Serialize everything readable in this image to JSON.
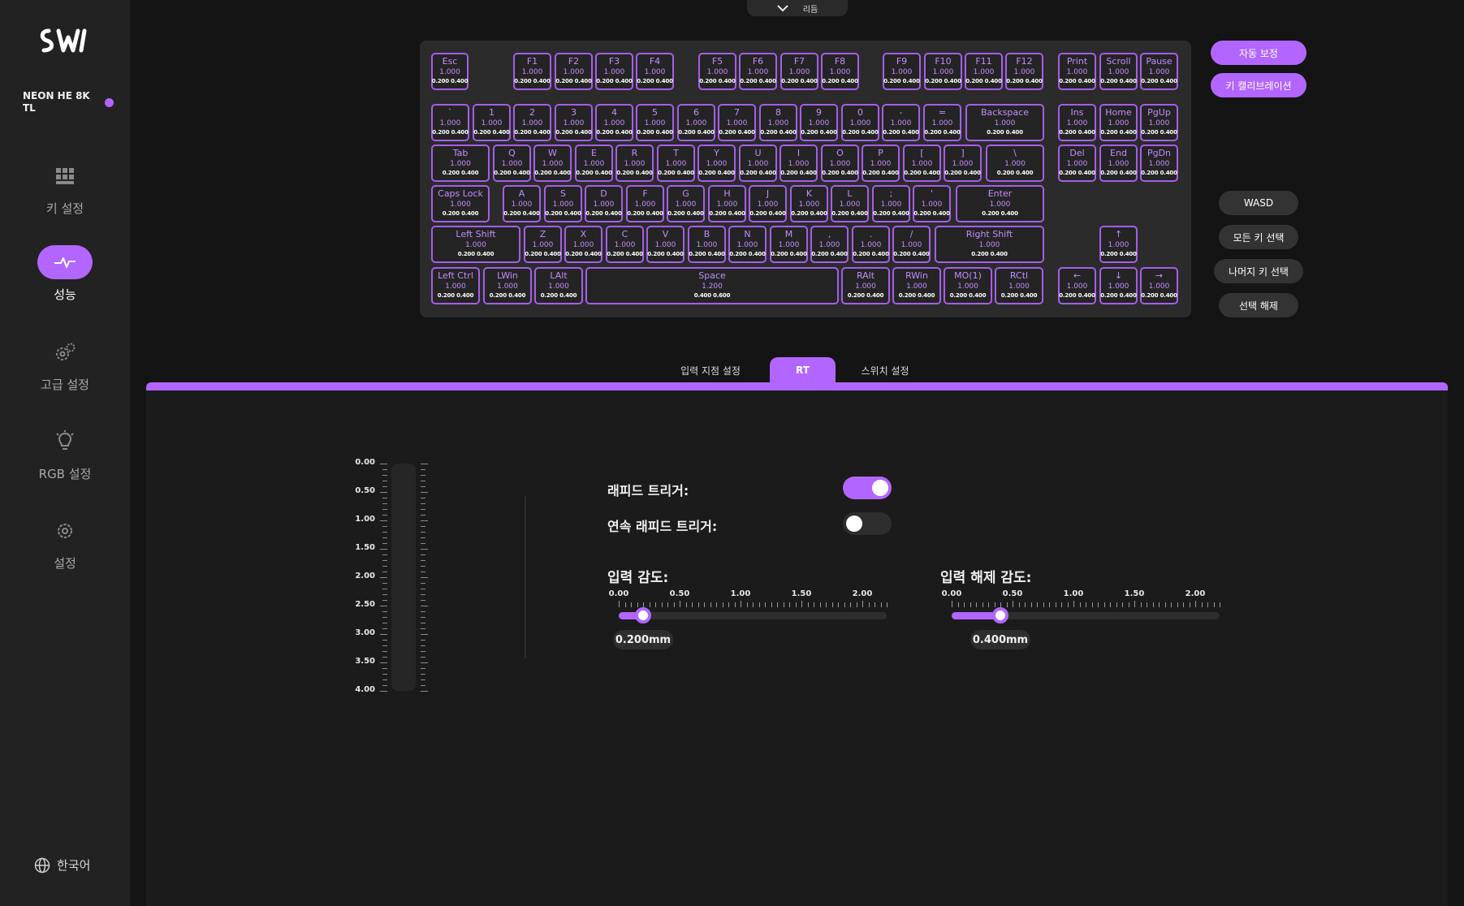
{
  "app": {
    "device_name": "NEON HE 8K TL",
    "status_color": "#b266ff"
  },
  "top_tab": {
    "label": "리듬"
  },
  "sidebar": {
    "items": [
      {
        "label": "키 설정",
        "icon": "grid-icon"
      },
      {
        "label": "성능",
        "icon": "pulse-icon",
        "active": true
      },
      {
        "label": "고급 설정",
        "icon": "gears-icon"
      },
      {
        "label": "RGB 설정",
        "icon": "bulb-icon"
      },
      {
        "label": "설정",
        "icon": "gear-icon"
      }
    ],
    "language": "한국어"
  },
  "keyboard": {
    "rows": [
      [
        {
          "label": "Esc",
          "val": "1.000",
          "sub": "0.200 0.400"
        },
        {
          "label": "F1",
          "val": "1.000",
          "sub": "0.200 0.400"
        },
        {
          "label": "F2",
          "val": "1.000",
          "sub": "0.200 0.400"
        },
        {
          "label": "F3",
          "val": "1.000",
          "sub": "0.200 0.400"
        },
        {
          "label": "F4",
          "val": "1.000",
          "sub": "0.200 0.400"
        },
        {
          "label": "F5",
          "val": "1.000",
          "sub": "0.200 0.400"
        },
        {
          "label": "F6",
          "val": "1.000",
          "sub": "0.200 0.400"
        },
        {
          "label": "F7",
          "val": "1.000",
          "sub": "0.200 0.400"
        },
        {
          "label": "F8",
          "val": "1.000",
          "sub": "0.200 0.400"
        },
        {
          "label": "F9",
          "val": "1.000",
          "sub": "0.200 0.400"
        },
        {
          "label": "F10",
          "val": "1.000",
          "sub": "0.200 0.400"
        },
        {
          "label": "F11",
          "val": "1.000",
          "sub": "0.200 0.400"
        },
        {
          "label": "F12",
          "val": "1.000",
          "sub": "0.200 0.400"
        },
        {
          "label": "Print",
          "val": "1.000",
          "sub": "0.200 0.400"
        },
        {
          "label": "Scroll",
          "val": "1.000",
          "sub": "0.200 0.400"
        },
        {
          "label": "Pause",
          "val": "1.000",
          "sub": "0.200 0.400"
        }
      ],
      [
        {
          "label": "`",
          "val": "1.000",
          "sub": "0.200 0.400"
        },
        {
          "label": "1",
          "val": "1.000",
          "sub": "0.200 0.400"
        },
        {
          "label": "2",
          "val": "1.000",
          "sub": "0.200 0.400"
        },
        {
          "label": "3",
          "val": "1.000",
          "sub": "0.200 0.400"
        },
        {
          "label": "4",
          "val": "1.000",
          "sub": "0.200 0.400"
        },
        {
          "label": "5",
          "val": "1.000",
          "sub": "0.200 0.400"
        },
        {
          "label": "6",
          "val": "1.000",
          "sub": "0.200 0.400"
        },
        {
          "label": "7",
          "val": "1.000",
          "sub": "0.200 0.400"
        },
        {
          "label": "8",
          "val": "1.000",
          "sub": "0.200 0.400"
        },
        {
          "label": "9",
          "val": "1.000",
          "sub": "0.200 0.400"
        },
        {
          "label": "0",
          "val": "1.000",
          "sub": "0.200 0.400"
        },
        {
          "label": "-",
          "val": "1.000",
          "sub": "0.200 0.400"
        },
        {
          "label": "=",
          "val": "1.000",
          "sub": "0.200 0.400"
        },
        {
          "label": "Backspace",
          "val": "1.000",
          "sub": "0.200 0.400"
        },
        {
          "label": "Ins",
          "val": "1.000",
          "sub": "0.200 0.400"
        },
        {
          "label": "Home",
          "val": "1.000",
          "sub": "0.200 0.400"
        },
        {
          "label": "PgUp",
          "val": "1.000",
          "sub": "0.200 0.400"
        }
      ],
      [
        {
          "label": "Tab",
          "val": "1.000",
          "sub": "0.200 0.400"
        },
        {
          "label": "Q",
          "val": "1.000",
          "sub": "0.200 0.400"
        },
        {
          "label": "W",
          "val": "1.000",
          "sub": "0.200 0.400"
        },
        {
          "label": "E",
          "val": "1.000",
          "sub": "0.200 0.400"
        },
        {
          "label": "R",
          "val": "1.000",
          "sub": "0.200 0.400"
        },
        {
          "label": "T",
          "val": "1.000",
          "sub": "0.200 0.400"
        },
        {
          "label": "Y",
          "val": "1.000",
          "sub": "0.200 0.400"
        },
        {
          "label": "U",
          "val": "1.000",
          "sub": "0.200 0.400"
        },
        {
          "label": "I",
          "val": "1.000",
          "sub": "0.200 0.400"
        },
        {
          "label": "O",
          "val": "1.000",
          "sub": "0.200 0.400"
        },
        {
          "label": "P",
          "val": "1.000",
          "sub": "0.200 0.400"
        },
        {
          "label": "[",
          "val": "1.000",
          "sub": "0.200 0.400"
        },
        {
          "label": "]",
          "val": "1.000",
          "sub": "0.200 0.400"
        },
        {
          "label": "\\",
          "val": "1.000",
          "sub": "0.200 0.400"
        },
        {
          "label": "Del",
          "val": "1.000",
          "sub": "0.200 0.400"
        },
        {
          "label": "End",
          "val": "1.000",
          "sub": "0.200 0.400"
        },
        {
          "label": "PgDn",
          "val": "1.000",
          "sub": "0.200 0.400"
        }
      ],
      [
        {
          "label": "Caps Lock",
          "val": "1.000",
          "sub": "0.200 0.400"
        },
        {
          "label": "A",
          "val": "1.000",
          "sub": "0.200 0.400"
        },
        {
          "label": "S",
          "val": "1.000",
          "sub": "0.200 0.400"
        },
        {
          "label": "D",
          "val": "1.000",
          "sub": "0.200 0.400"
        },
        {
          "label": "F",
          "val": "1.000",
          "sub": "0.200 0.400"
        },
        {
          "label": "G",
          "val": "1.000",
          "sub": "0.200 0.400"
        },
        {
          "label": "H",
          "val": "1.000",
          "sub": "0.200 0.400"
        },
        {
          "label": "J",
          "val": "1.000",
          "sub": "0.200 0.400"
        },
        {
          "label": "K",
          "val": "1.000",
          "sub": "0.200 0.400"
        },
        {
          "label": "L",
          "val": "1.000",
          "sub": "0.200 0.400"
        },
        {
          "label": ";",
          "val": "1.000",
          "sub": "0.200 0.400"
        },
        {
          "label": "'",
          "val": "1.000",
          "sub": "0.200 0.400"
        },
        {
          "label": "Enter",
          "val": "1.000",
          "sub": "0.200 0.400"
        }
      ],
      [
        {
          "label": "Left Shift",
          "val": "1.000",
          "sub": "0.200 0.400"
        },
        {
          "label": "Z",
          "val": "1.000",
          "sub": "0.200 0.400"
        },
        {
          "label": "X",
          "val": "1.000",
          "sub": "0.200 0.400"
        },
        {
          "label": "C",
          "val": "1.000",
          "sub": "0.200 0.400"
        },
        {
          "label": "V",
          "val": "1.000",
          "sub": "0.200 0.400"
        },
        {
          "label": "B",
          "val": "1.000",
          "sub": "0.200 0.400"
        },
        {
          "label": "N",
          "val": "1.000",
          "sub": "0.200 0.400"
        },
        {
          "label": "M",
          "val": "1.000",
          "sub": "0.200 0.400"
        },
        {
          "label": ",",
          "val": "1.000",
          "sub": "0.200 0.400"
        },
        {
          "label": ".",
          "val": "1.000",
          "sub": "0.200 0.400"
        },
        {
          "label": "/",
          "val": "1.000",
          "sub": "0.200 0.400"
        },
        {
          "label": "Right Shift",
          "val": "1.000",
          "sub": "0.200 0.400"
        },
        {
          "label": "↑",
          "val": "1.000",
          "sub": "0.200 0.400"
        }
      ],
      [
        {
          "label": "Left Ctrl",
          "val": "1.000",
          "sub": "0.200 0.400"
        },
        {
          "label": "LWin",
          "val": "1.000",
          "sub": "0.200 0.400"
        },
        {
          "label": "LAlt",
          "val": "1.000",
          "sub": "0.200 0.400"
        },
        {
          "label": "Space",
          "val": "1.200",
          "sub": "0.400 0.600"
        },
        {
          "label": "RAlt",
          "val": "1.000",
          "sub": "0.200 0.400"
        },
        {
          "label": "RWin",
          "val": "1.000",
          "sub": "0.200 0.400"
        },
        {
          "label": "MO(1)",
          "val": "1.000",
          "sub": "0.200 0.400"
        },
        {
          "label": "RCtl",
          "val": "1.000",
          "sub": "0.200 0.400"
        },
        {
          "label": "←",
          "val": "1.000",
          "sub": "0.200 0.400"
        },
        {
          "label": "↓",
          "val": "1.000",
          "sub": "0.200 0.400"
        },
        {
          "label": "→",
          "val": "1.000",
          "sub": "0.200 0.400"
        }
      ]
    ]
  },
  "actions": {
    "auto_calibrate": "자동 보정",
    "key_calibration": "키 캘리브레이션",
    "wasd": "WASD",
    "select_all": "모든 키 선택",
    "select_rest": "나머지 키 선택",
    "deselect": "선택 해제"
  },
  "tabs": [
    {
      "label": "입력 지점 설정"
    },
    {
      "label": "RT",
      "active": true
    },
    {
      "label": "스위치 설정"
    }
  ],
  "travel_gauge": {
    "labels": [
      "0.00",
      "0.50",
      "1.00",
      "1.50",
      "2.00",
      "2.50",
      "3.00",
      "3.50",
      "4.00"
    ]
  },
  "rt_settings": {
    "rapid_trigger_label": "래피드 트리거:",
    "rapid_trigger_on": true,
    "continuous_rapid_trigger_label": "연속 래피드 트리거:",
    "continuous_rapid_trigger_on": false,
    "press_sensitivity_label": "입력 감도:",
    "press_sensitivity_value": "0.200mm",
    "press_sensitivity_mm": 0.2,
    "release_sensitivity_label": "입력 해제 감도:",
    "release_sensitivity_value": "0.400mm",
    "release_sensitivity_mm": 0.4,
    "scale_labels": [
      "0.00",
      "0.50",
      "1.00",
      "1.50",
      "2.00"
    ],
    "scale_max": 2.2
  },
  "colors": {
    "accent": "#b266ff",
    "background": "#141414"
  }
}
